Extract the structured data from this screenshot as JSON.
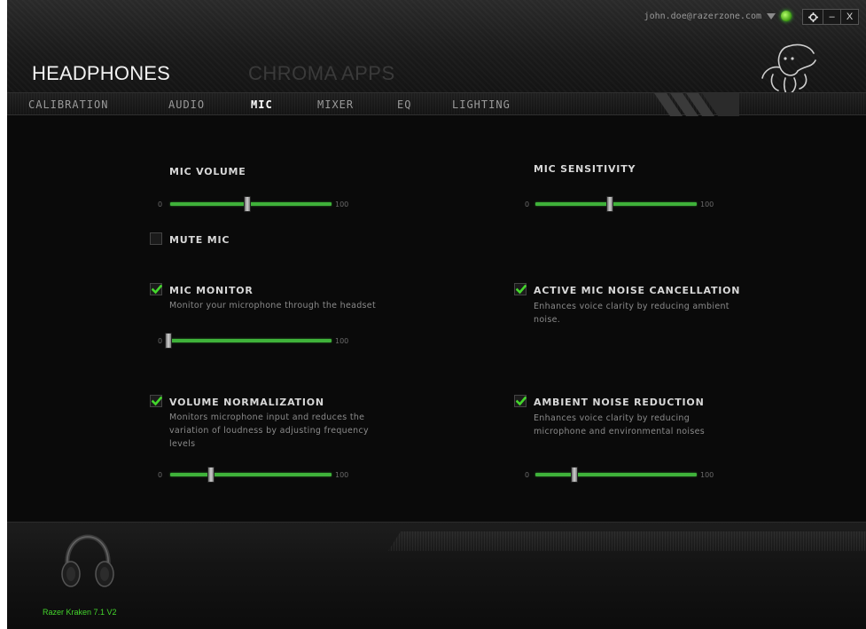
{
  "header": {
    "account_email": "john.doe@razerzone.com",
    "section_title": "HEADPHONES",
    "secondary_title": "CHROMA APPS",
    "window_controls": {
      "settings_icon": "gear-icon",
      "minimize": "–",
      "close": "X"
    }
  },
  "tabs": [
    {
      "label": "CALIBRATION",
      "active": false
    },
    {
      "label": "AUDIO",
      "active": false
    },
    {
      "label": "MIC",
      "active": true
    },
    {
      "label": "MIXER",
      "active": false
    },
    {
      "label": "EQ",
      "active": false
    },
    {
      "label": "LIGHTING",
      "active": false
    }
  ],
  "mic": {
    "volume": {
      "label": "MIC VOLUME",
      "min": "0",
      "max": "100",
      "value": 48
    },
    "sensitivity": {
      "label": "MIC SENSITIVITY",
      "min": "0",
      "max": "100",
      "value": 46
    },
    "mute": {
      "label": "MUTE MIC",
      "checked": false
    },
    "monitor": {
      "label": "MIC MONITOR",
      "description": "Monitor your microphone through the headset",
      "checked": true,
      "min": "0",
      "max": "100",
      "value": 1
    },
    "noise_cancellation": {
      "label": "ACTIVE MIC NOISE CANCELLATION",
      "description_line1": "Enhances voice clarity by reducing ambient",
      "description_line2": "noise.",
      "checked": true
    },
    "normalization": {
      "label": "VOLUME NORMALIZATION",
      "description_line1": "Monitors microphone input and reduces the",
      "description_line2": "variation of loudness by adjusting frequency",
      "description_line3": "levels",
      "checked": true,
      "min": "0",
      "max": "100",
      "value": 25
    },
    "ambient_reduction": {
      "label": "AMBIENT NOISE REDUCTION",
      "description_line1": "Enhances voice clarity by reducing",
      "description_line2": "microphone and environmental noises",
      "checked": true,
      "min": "0",
      "max": "100",
      "value": 24
    }
  },
  "footer": {
    "device_name": "Razer Kraken 7.1 V2",
    "device_icon": "headset-icon"
  },
  "colors": {
    "accent": "#44d62c",
    "track": "#3fb23a",
    "background": "#0a0a0a"
  }
}
